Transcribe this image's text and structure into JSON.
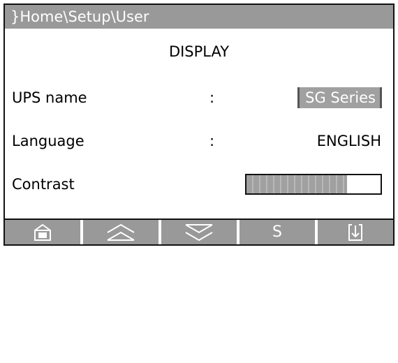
{
  "titlebar": {
    "path": "}Home\\Setup\\User"
  },
  "heading": "DISPLAY",
  "rows": [
    {
      "label": "UPS name",
      "sep": ":",
      "value": "SG Series"
    },
    {
      "label": "Language",
      "sep": ":",
      "value": "ENGLISH"
    },
    {
      "label": "Contrast",
      "level": 0.75
    }
  ],
  "function_keys": [
    {
      "icon": "home-icon"
    },
    {
      "icon": "up-chevron-icon"
    },
    {
      "icon": "down-chevron-icon"
    },
    {
      "icon": "s-key",
      "label": "S"
    },
    {
      "icon": "enter-icon"
    }
  ],
  "colors": {
    "bar": "#999999",
    "fill": "#a0a0a0",
    "border": "#111111"
  }
}
